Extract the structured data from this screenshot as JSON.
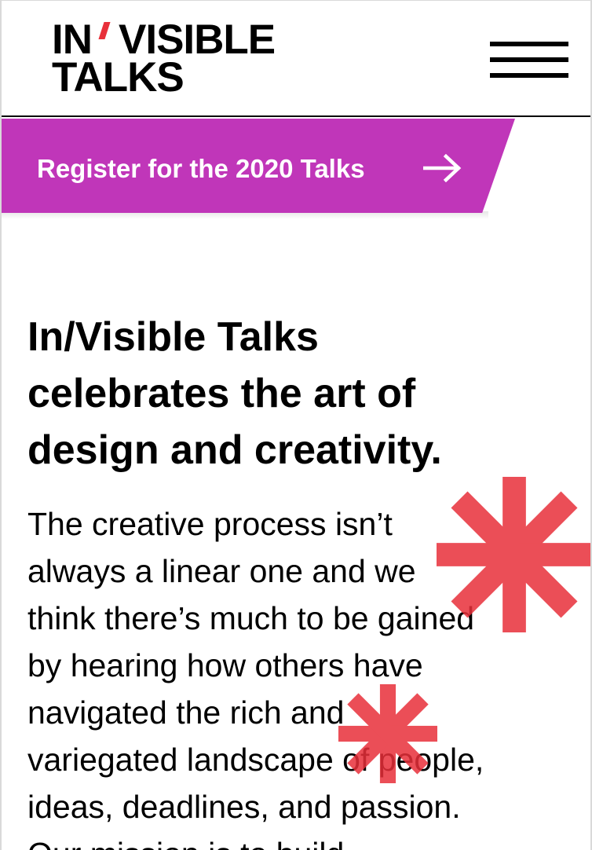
{
  "header": {
    "logo_line1_left": "IN",
    "logo_line1_right": "VISIBLE",
    "logo_line2": "TALKS",
    "menu_icon": "hamburger-menu-icon"
  },
  "banner": {
    "label": "Register for the 2020 Talks",
    "icon": "arrow-right-icon",
    "color": "#c036b9"
  },
  "main": {
    "headline_lines": [
      "In/Visible Talks",
      "celebrates the art of",
      "design and creativity."
    ],
    "body_lines": [
      "The creative process isn’t",
      "always a linear one and we",
      "think there’s much to be gained",
      "by hearing how others have",
      "navigated the rich and",
      "variegated landscape of people,",
      "ideas, deadlines, and passion.",
      "Our mission is to build"
    ]
  },
  "decor": {
    "asterisk_color": "#e8303a",
    "asterisk_icon": "asterisk-icon"
  },
  "colors": {
    "accent": "#c036b9",
    "logo_slash": "#e8303a",
    "text": "#000000",
    "background": "#ffffff"
  }
}
